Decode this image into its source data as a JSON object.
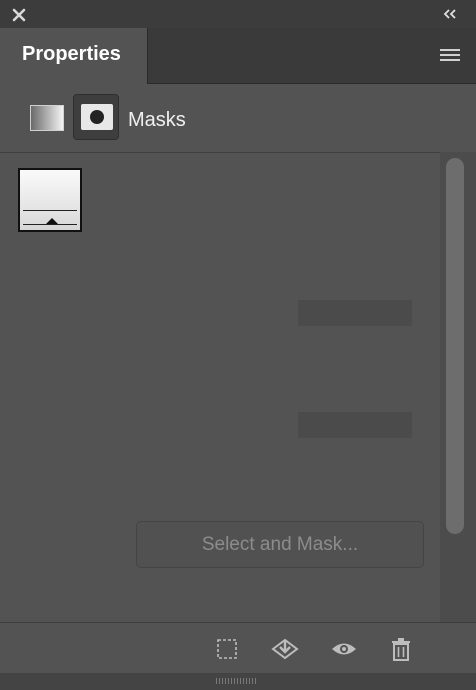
{
  "topbar": {
    "close_icon": "close-icon",
    "collapse_icon": "double-chevron-left-icon"
  },
  "tabs": [
    {
      "label": "Properties",
      "active": true
    }
  ],
  "panel_menu_icon": "hamburger-menu-icon",
  "mode": {
    "label": "Masks",
    "pixel_mask_icon": "pixel-mask-icon",
    "vector_mask_icon": "vector-mask-icon"
  },
  "thumbnail_icon": "mask-thumbnail",
  "select_and_mask_label": "Select and Mask...",
  "bottom_icons": [
    "selection-from-mask-icon",
    "apply-mask-icon",
    "visibility-eye-icon",
    "delete-trash-icon"
  ],
  "colors": {
    "panel_bg": "#535353",
    "frame_bg": "#3a3a3a",
    "active_text": "#ffffff",
    "disabled_text": "#8c8c8c"
  }
}
